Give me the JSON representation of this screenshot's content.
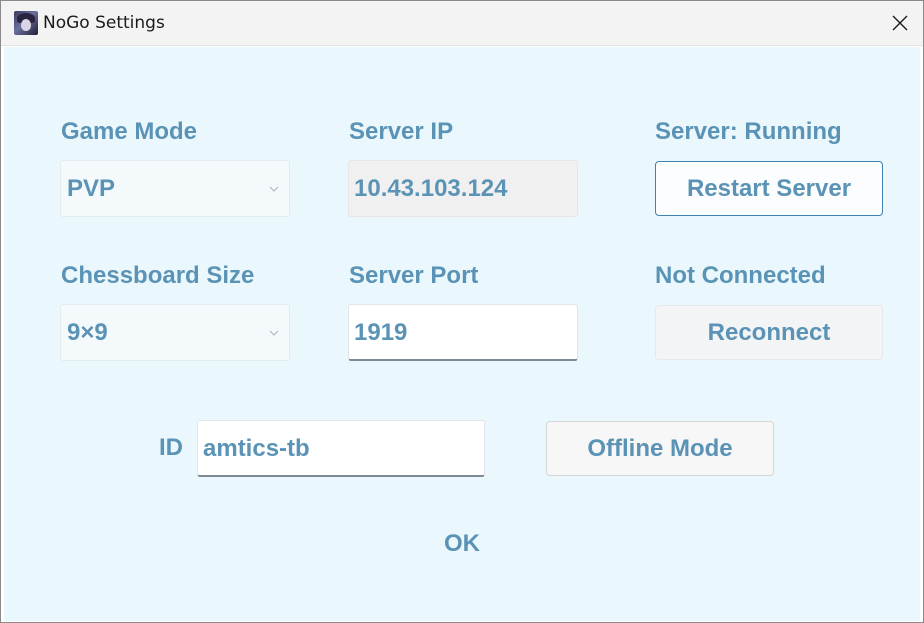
{
  "window": {
    "title": "NoGo Settings"
  },
  "game_mode": {
    "label": "Game Mode",
    "value": "PVP"
  },
  "server_ip": {
    "label": "Server IP",
    "value": "10.43.103.124"
  },
  "server_status": {
    "label": "Server: Running",
    "button": "Restart Server"
  },
  "board_size": {
    "label": "Chessboard Size",
    "value": "9×9"
  },
  "server_port": {
    "label": "Server Port",
    "value": "1919"
  },
  "connection": {
    "label": "Not Connected",
    "button": "Reconnect"
  },
  "id": {
    "label": "ID",
    "value": "amtics-tb"
  },
  "offline_button": "Offline Mode",
  "ok_button": "OK",
  "colors": {
    "accent_text": "#5a93b5",
    "client_bg": "#eaf8fd",
    "accent_border": "#3f82b1"
  },
  "icons": {
    "close": "close-icon",
    "app": "app-icon",
    "dropdown": "chevron-down-icon"
  }
}
